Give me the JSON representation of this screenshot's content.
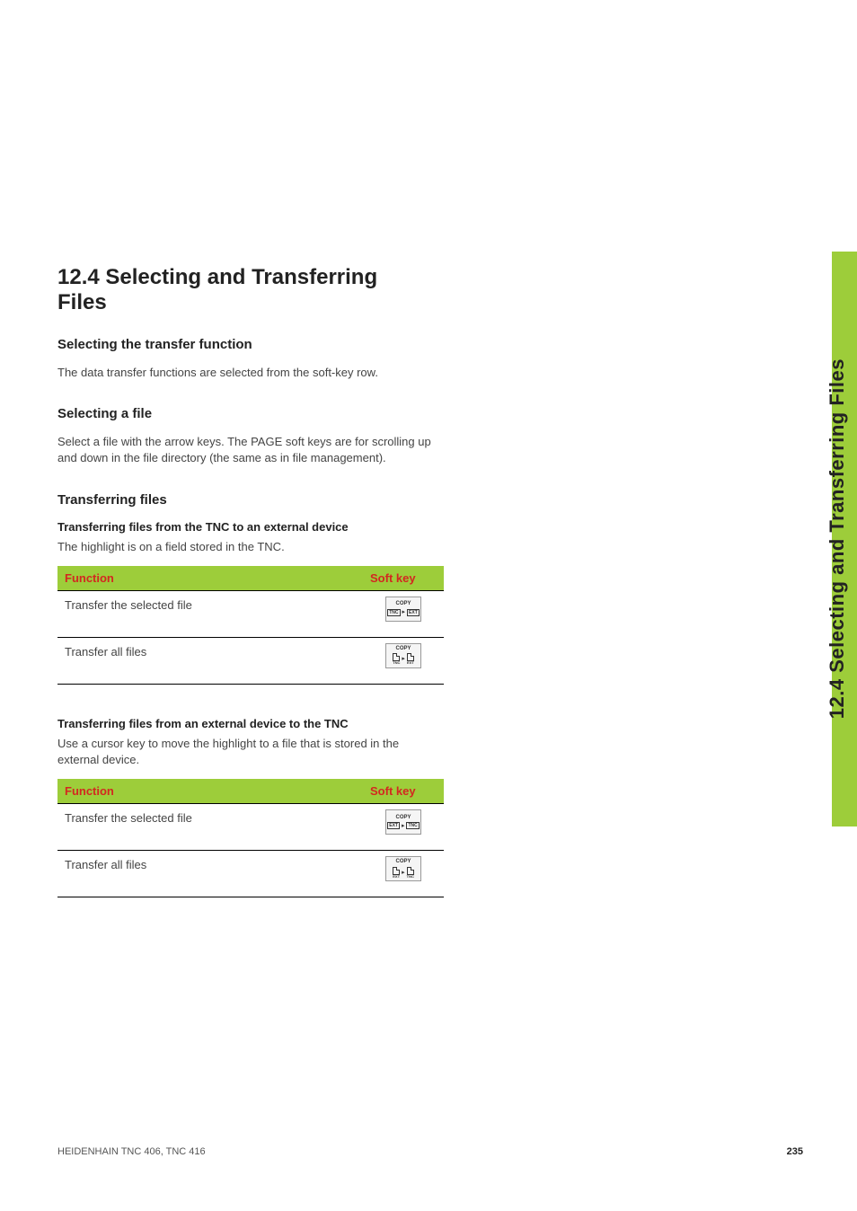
{
  "section": {
    "number_title": "12.4 Selecting and Transferring Files"
  },
  "subsection1": {
    "heading": "Selecting the transfer function",
    "body": "The data transfer functions are selected from the soft-key row."
  },
  "subsection2": {
    "heading": "Selecting a file",
    "body": "Select a file with the arrow keys.\nThe PAGE soft keys are for scrolling up and down in the file directory (the same as in file management)."
  },
  "subsection3": {
    "heading": "Transferring files",
    "group1": {
      "title": "Transferring files from the TNC to an external device",
      "desc": "The highlight is on a field stored in the TNC.",
      "table": {
        "headers": {
          "function": "Function",
          "softkey": "Soft key"
        },
        "rows": [
          {
            "function": "Transfer the selected file",
            "icon": {
              "label": "COPY",
              "from": "TNC",
              "to": "EXT",
              "style": "box"
            }
          },
          {
            "function": "Transfer all files",
            "icon": {
              "label": "COPY",
              "from": "TNC",
              "to": "EXT",
              "style": "doc"
            }
          }
        ]
      }
    },
    "group2": {
      "title": "Transferring files from an external device to the TNC",
      "desc": "Use a cursor key to move the highlight to a file that is stored in the external device.",
      "table": {
        "headers": {
          "function": "Function",
          "softkey": "Soft key"
        },
        "rows": [
          {
            "function": "Transfer the selected file",
            "icon": {
              "label": "COPY",
              "from": "EXT",
              "to": "TNC",
              "style": "box"
            }
          },
          {
            "function": "Transfer all files",
            "icon": {
              "label": "COPY",
              "from": "EXT",
              "to": "TNC",
              "style": "doc"
            }
          }
        ]
      }
    }
  },
  "side_tab": "12.4 Selecting and Transferring Files",
  "footer": {
    "left": "HEIDENHAIN TNC 406, TNC 416",
    "page": "235"
  }
}
